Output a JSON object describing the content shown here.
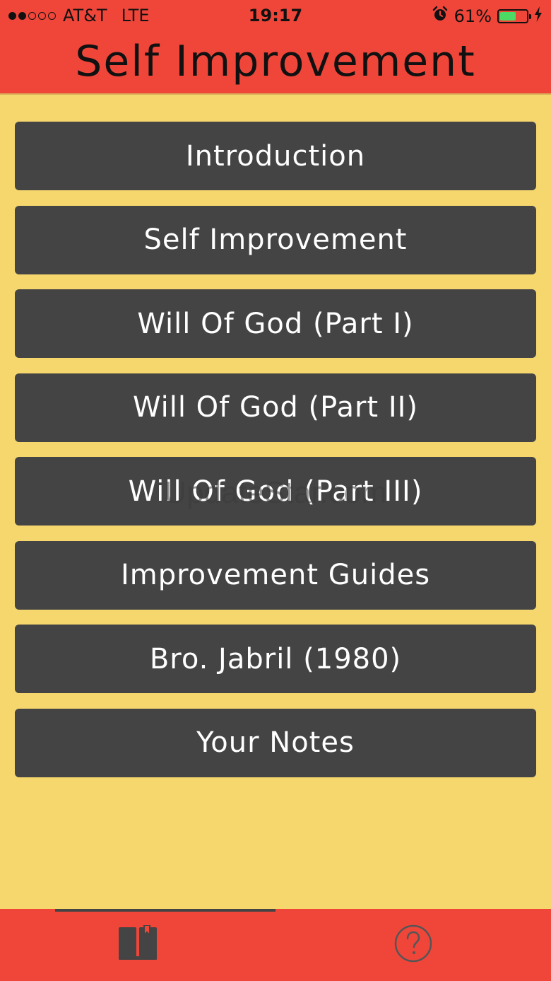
{
  "status_bar": {
    "carrier": "AT&T",
    "network": "LTE",
    "time": "19:17",
    "battery_percent": "61%",
    "battery_level": 0.61,
    "signal_bars_filled": 2,
    "signal_bars_total": 5,
    "alarm_icon": "alarm-clock-icon",
    "charging_icon": "lightning-bolt-icon"
  },
  "header": {
    "title": "Self Improvement"
  },
  "menu": {
    "items": [
      {
        "label": "Introduction"
      },
      {
        "label": "Self Improvement"
      },
      {
        "label": "Will Of God (Part I)"
      },
      {
        "label": "Will Of God (Part II)"
      },
      {
        "label": "Will Of God (Part III)"
      },
      {
        "label": "Improvement Guides"
      },
      {
        "label": "Bro. Jabril (1980)"
      },
      {
        "label": "Your Notes"
      }
    ]
  },
  "watermark": {
    "text": "UpdateStar.com"
  },
  "tab_bar": {
    "tabs": [
      {
        "icon": "book-bookmark-icon",
        "selected": true
      },
      {
        "icon": "help-circle-icon",
        "selected": false
      }
    ]
  },
  "colors": {
    "header_bg": "#f0463a",
    "page_bg": "#f5d76e",
    "button_bg": "#444444",
    "button_text": "#ffffff",
    "battery_fill": "#4cd964"
  }
}
